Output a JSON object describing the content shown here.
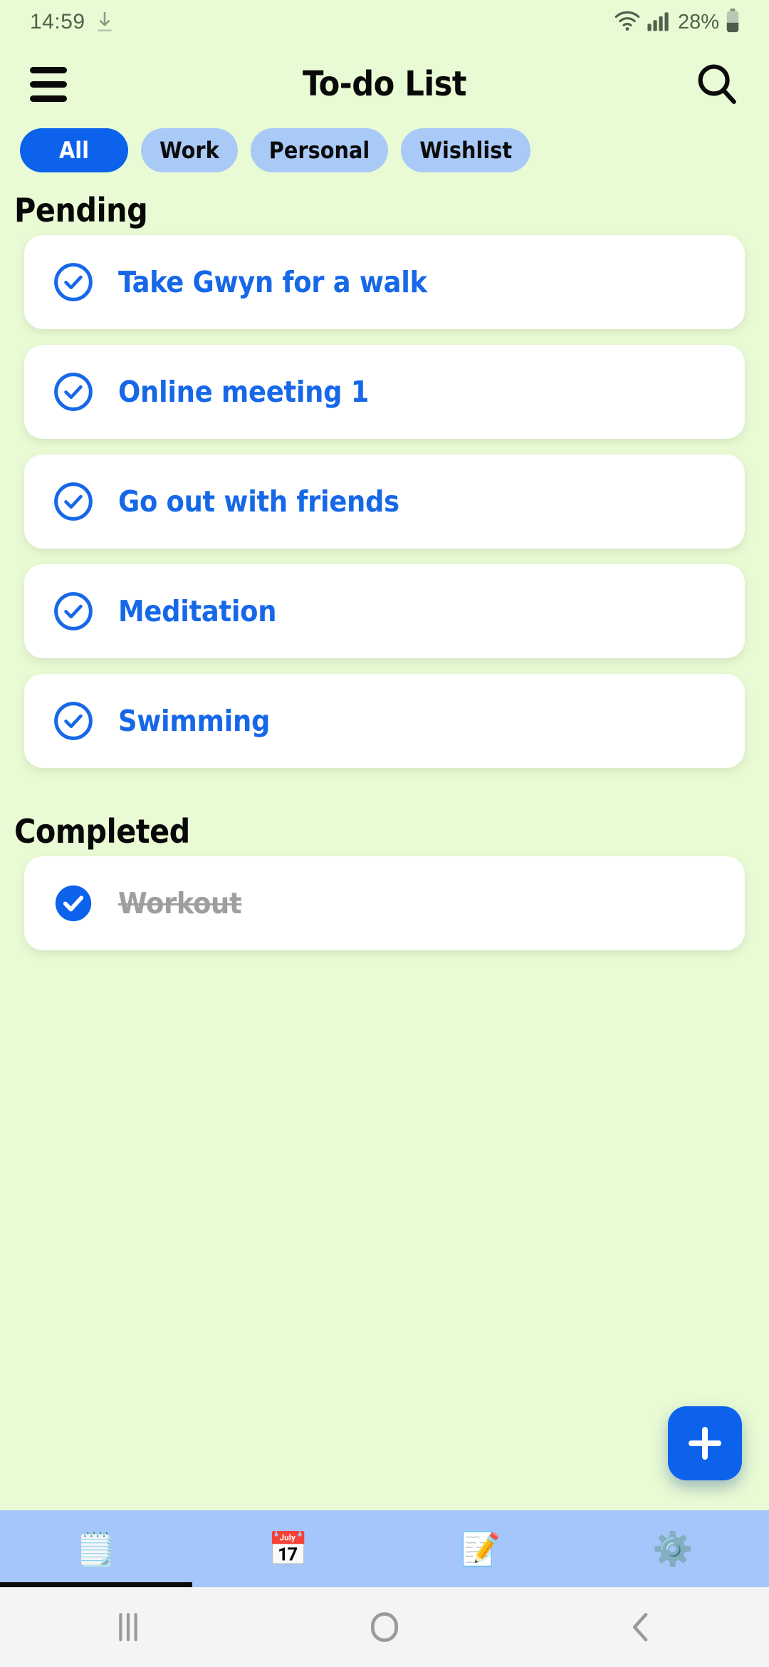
{
  "status_bar": {
    "time": "14:59",
    "download_icon": "download-icon",
    "wifi_icon": "wifi-icon",
    "signal_icon": "cellular-signal-icon",
    "battery_percent": "28%",
    "battery_icon": "battery-icon"
  },
  "app_bar": {
    "menu_icon": "hamburger-menu-icon",
    "title": "To-do List",
    "search_icon": "search-icon"
  },
  "filters": {
    "chips": [
      {
        "label": "All",
        "active": true
      },
      {
        "label": "Work",
        "active": false
      },
      {
        "label": "Personal",
        "active": false
      },
      {
        "label": "Wishlist",
        "active": false
      }
    ],
    "active_color": "#0d62ec",
    "inactive_color": "#a9c9f7"
  },
  "sections": [
    {
      "title": "Pending",
      "tasks": [
        {
          "label": "Take Gwyn for a walk",
          "done": false
        },
        {
          "label": "Online meeting 1",
          "done": false
        },
        {
          "label": "Go out with friends",
          "done": false
        },
        {
          "label": "Meditation",
          "done": false
        },
        {
          "label": "Swimming",
          "done": false
        }
      ]
    },
    {
      "title": "Completed",
      "tasks": [
        {
          "label": "Workout",
          "done": true
        }
      ]
    }
  ],
  "fab": {
    "icon": "plus-icon",
    "label": "Add task",
    "color": "#0d62ec"
  },
  "bottom_nav": [
    {
      "icon": "checklist-notepad-icon",
      "glyph": "🗒️",
      "active": true
    },
    {
      "icon": "calendar-icon",
      "glyph": "📅",
      "active": false
    },
    {
      "icon": "sticky-note-icon",
      "glyph": "📝",
      "active": false
    },
    {
      "icon": "settings-gear-icon",
      "glyph": "⚙️",
      "active": false
    }
  ],
  "system_nav": {
    "recents_icon": "recents-icon",
    "home_icon": "home-icon",
    "back_icon": "back-icon"
  },
  "theme": {
    "background": "#e9fbd4",
    "card_background": "#ffffff",
    "accent_blue": "#0d62ec",
    "task_text_blue": "#1668e8",
    "completed_text": "#9e9e9e",
    "bottom_nav_background": "#a5c6fa"
  }
}
